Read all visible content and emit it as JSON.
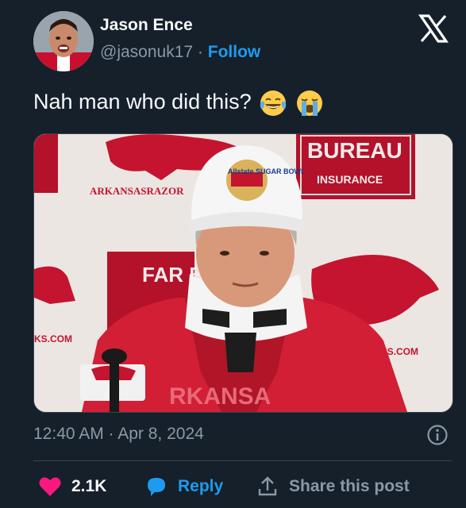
{
  "author": {
    "display_name": "Jason Ence",
    "handle": "@jasonuk17",
    "separator": "·",
    "follow_label": "Follow"
  },
  "tweet": {
    "text": "Nah man who did this?",
    "emojis": [
      "face-with-tears-of-joy",
      "loudly-crying-face"
    ],
    "media_alt": "",
    "media_texts": {
      "sign_top": "BUREAU",
      "sign_sub": "INSURANCE",
      "sign_mid": "FAR BUR",
      "cap_text": "Allstate SUGAR BOWL",
      "left_wall": "ARKANSASRAZOR",
      "right_wall": "RACKS.COM",
      "left_wall2": "KS.COM",
      "jacket_text": "RKANSA"
    }
  },
  "meta": {
    "timestamp": "12:40 AM · Apr 8, 2024"
  },
  "actions": {
    "likes_count": "2.1K",
    "reply_label": "Reply",
    "share_label": "Share this post"
  },
  "icons": {
    "logo": "x-logo-icon",
    "info": "info-icon",
    "like": "heart-icon",
    "reply": "reply-bubble-icon",
    "share": "share-upload-icon"
  },
  "colors": {
    "background": "#15202b",
    "primary_text": "#f7f9f9",
    "secondary_text": "#8b98a5",
    "link_blue": "#1d9bf0",
    "heart_pink": "#f91880",
    "divider": "#38444d"
  }
}
